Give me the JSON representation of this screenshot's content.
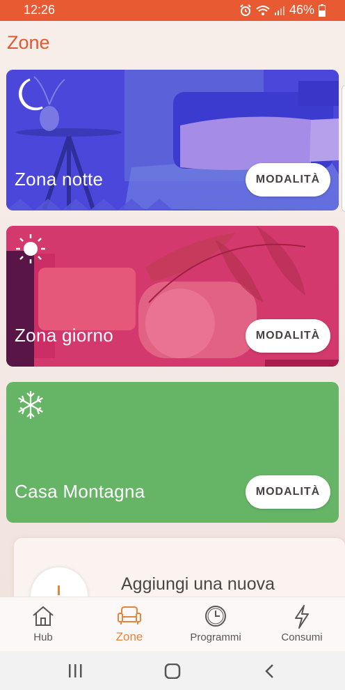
{
  "status": {
    "time": "12:26",
    "battery": "46%",
    "icons": [
      "alarm-icon",
      "wifi-icon",
      "signal-icon",
      "battery-icon"
    ]
  },
  "page": {
    "title": "Zone"
  },
  "zones": [
    {
      "name": "Zona notte",
      "icon": "moon-icon",
      "mode_label": "MODALITÀ",
      "color": "#4b48d8"
    },
    {
      "name": "Zona giorno",
      "icon": "sun-icon",
      "mode_label": "MODALITÀ",
      "color": "#d3396d"
    },
    {
      "name": "Casa Montagna",
      "icon": "snowflake-icon",
      "mode_label": "MODALITÀ",
      "color": "#66b566"
    }
  ],
  "add_zone": {
    "label": "Aggiungi una nuova"
  },
  "tabs": [
    {
      "label": "Hub",
      "icon": "house-icon",
      "active": false
    },
    {
      "label": "Zone",
      "icon": "sofa-icon",
      "active": true
    },
    {
      "label": "Programmi",
      "icon": "clock-icon",
      "active": false
    },
    {
      "label": "Consumi",
      "icon": "lightning-icon",
      "active": false
    }
  ],
  "system_nav": [
    "recent-apps-icon",
    "home-icon",
    "back-icon"
  ],
  "colors": {
    "accent": "#e85a32",
    "active_tab": "#e8843a"
  }
}
